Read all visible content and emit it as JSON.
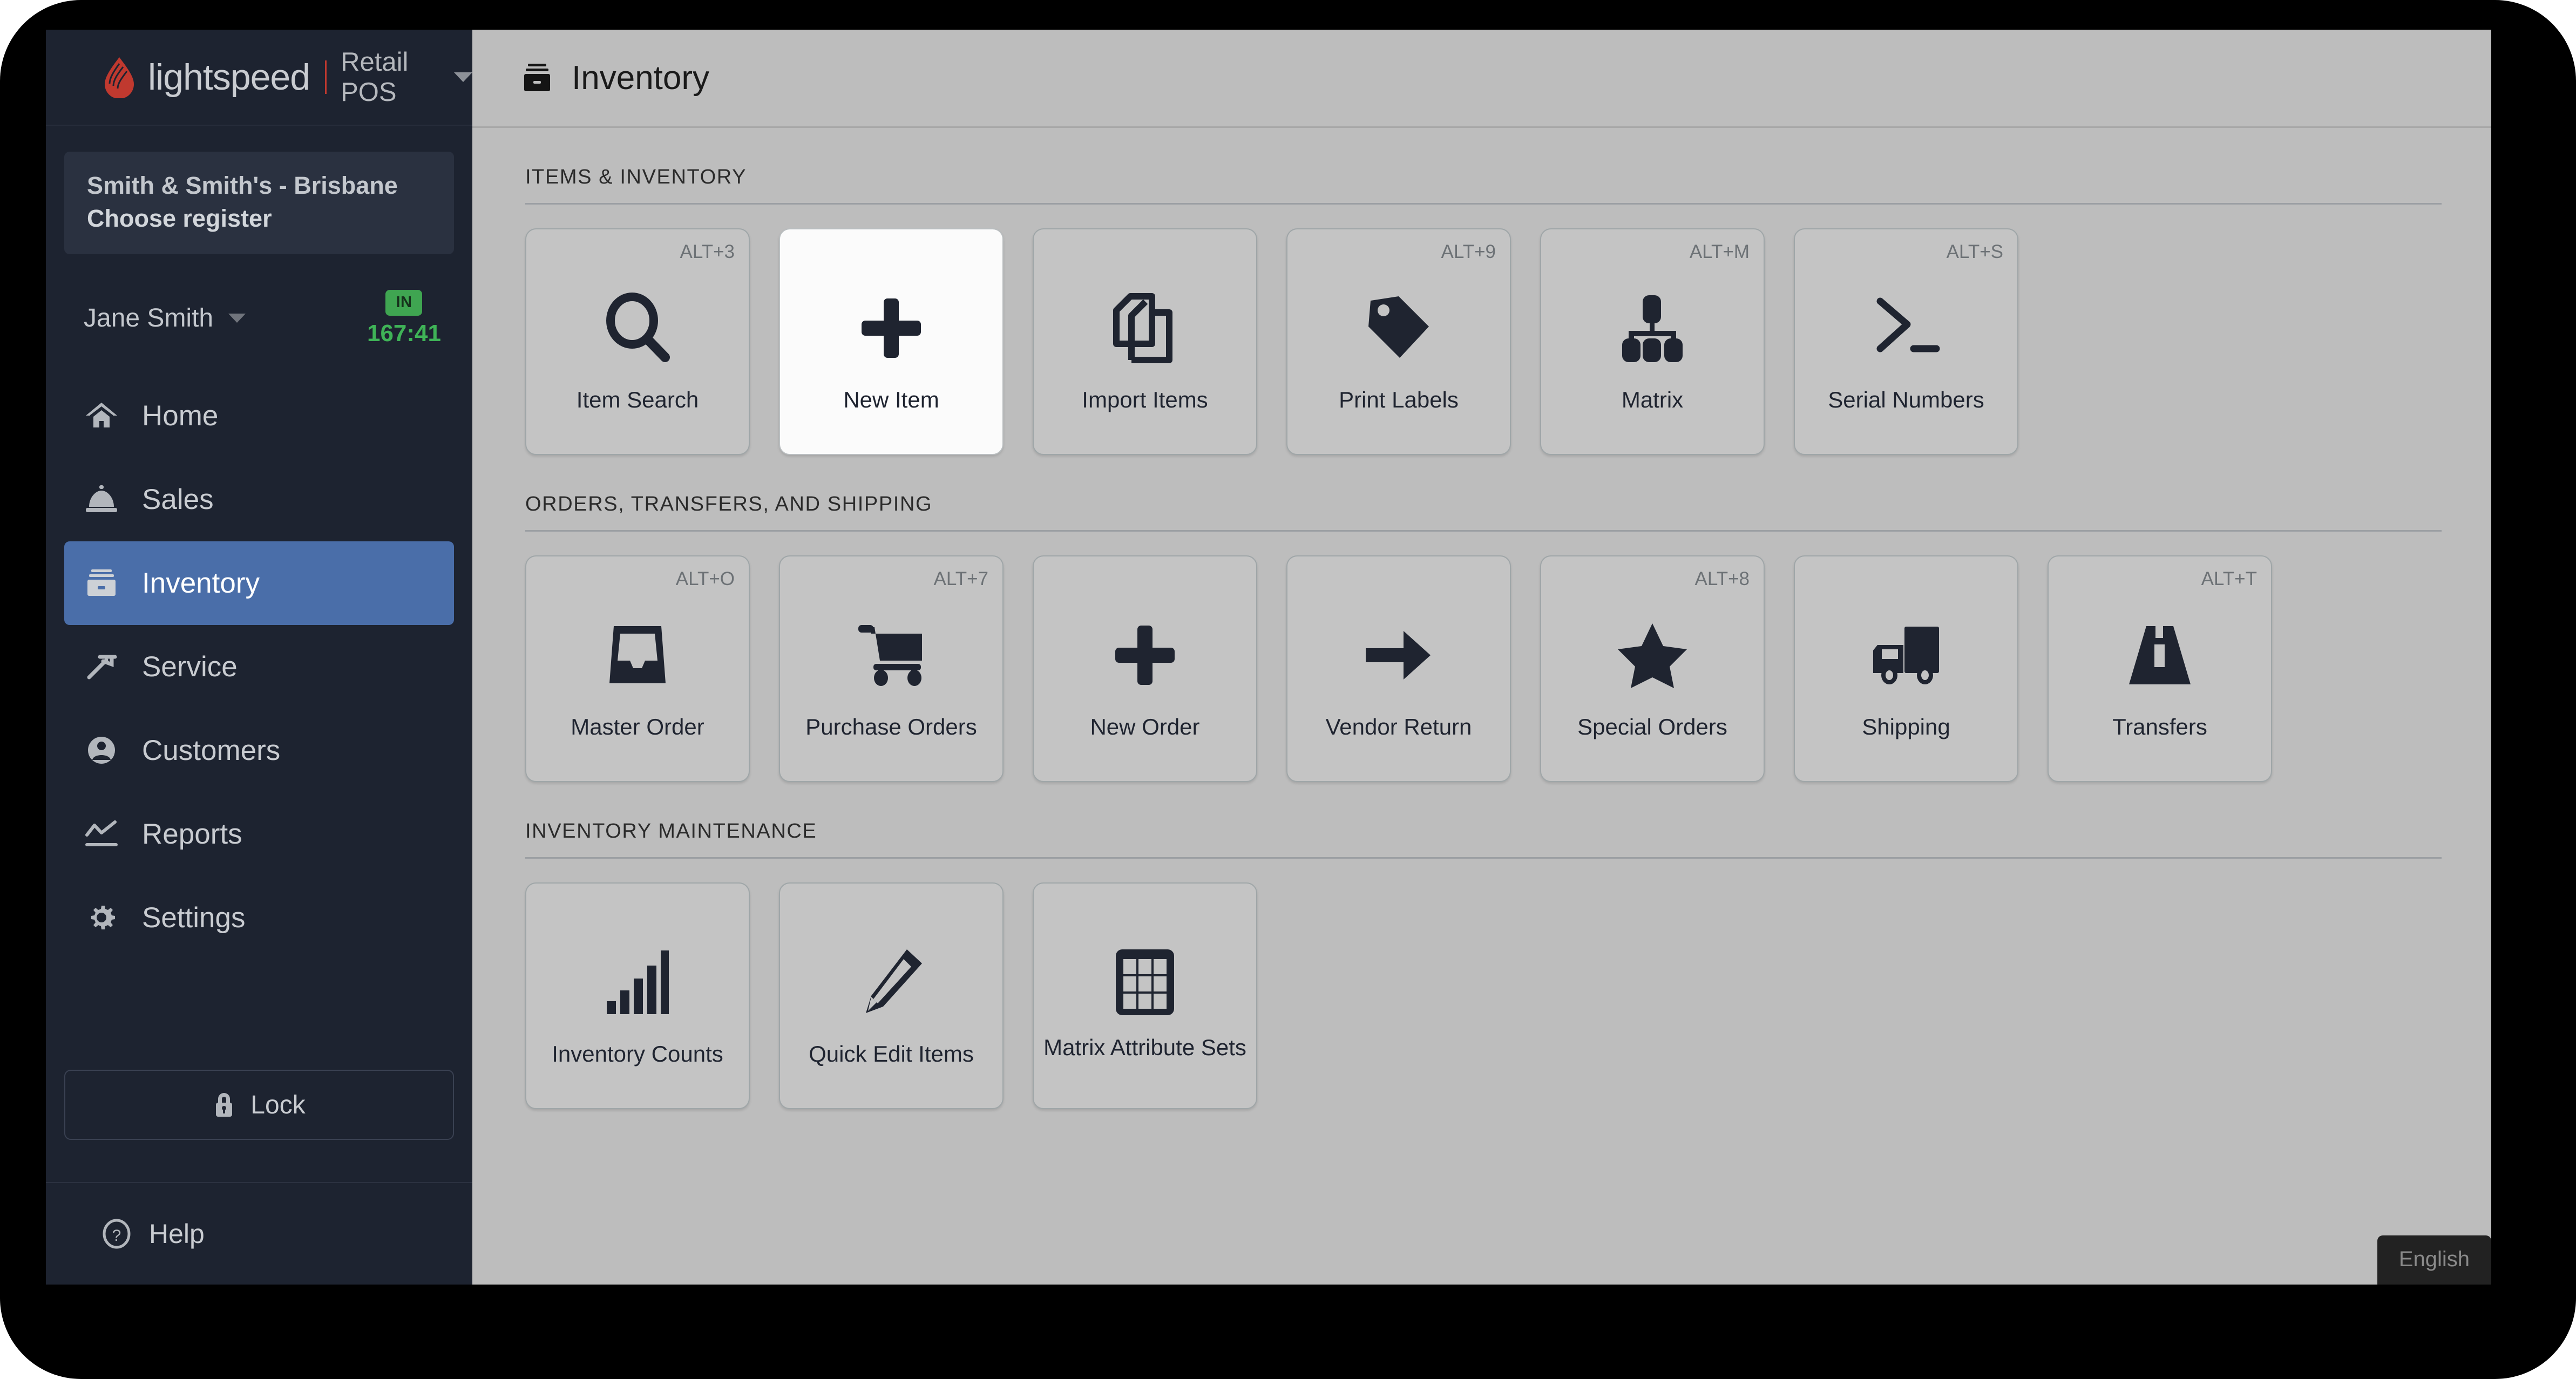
{
  "brand": {
    "flame_color": "#c0392f",
    "name": "lightspeed",
    "product": "Retail POS",
    "caret": "chevron-down-icon"
  },
  "sidebar": {
    "register": {
      "shop": "Smith & Smith's - Brisbane",
      "choose": "Choose register"
    },
    "user": {
      "name": "Jane Smith",
      "status_badge": "IN",
      "status_color": "#3fa551",
      "clock_time": "167:41",
      "clock_color": "#3fb357"
    },
    "nav_items": [
      {
        "label": "Home",
        "icon": "home-icon",
        "active": false
      },
      {
        "label": "Sales",
        "icon": "bell-icon",
        "active": false
      },
      {
        "label": "Inventory",
        "icon": "inventory-drawer-icon",
        "active": true
      },
      {
        "label": "Service",
        "icon": "hammer-icon",
        "active": false
      },
      {
        "label": "Customers",
        "icon": "person-circle-icon",
        "active": false
      },
      {
        "label": "Reports",
        "icon": "line-chart-icon",
        "active": false
      },
      {
        "label": "Settings",
        "icon": "gear-icon",
        "active": false
      }
    ],
    "active_color": "#4a6ea9",
    "lock_button": {
      "label": "Lock",
      "icon": "lock-icon"
    },
    "help": {
      "label": "Help",
      "icon": "question-circle-icon"
    }
  },
  "header": {
    "title": "Inventory",
    "icon": "inventory-drawer-icon"
  },
  "sections": [
    {
      "title": "ITEMS & INVENTORY",
      "tiles": [
        {
          "label": "Item Search",
          "shortcut": "ALT+3",
          "icon": "magnifier-icon",
          "selected": false
        },
        {
          "label": "New Item",
          "shortcut": "",
          "icon": "plus-icon",
          "selected": true
        },
        {
          "label": "Import Items",
          "shortcut": "",
          "icon": "copy-pages-icon",
          "selected": false
        },
        {
          "label": "Print Labels",
          "shortcut": "ALT+9",
          "icon": "price-tag-icon",
          "selected": false
        },
        {
          "label": "Matrix",
          "shortcut": "ALT+M",
          "icon": "org-tree-icon",
          "selected": false
        },
        {
          "label": "Serial Numbers",
          "shortcut": "ALT+S",
          "icon": "terminal-icon",
          "selected": false
        }
      ]
    },
    {
      "title": "ORDERS, TRANSFERS, AND SHIPPING",
      "tiles": [
        {
          "label": "Master Order",
          "shortcut": "ALT+O",
          "icon": "inbox-tray-icon",
          "selected": false
        },
        {
          "label": "Purchase Orders",
          "shortcut": "ALT+7",
          "icon": "shopping-cart-icon",
          "selected": false
        },
        {
          "label": "New Order",
          "shortcut": "",
          "icon": "plus-icon",
          "selected": false
        },
        {
          "label": "Vendor Return",
          "shortcut": "",
          "icon": "arrow-right-icon",
          "selected": false
        },
        {
          "label": "Special Orders",
          "shortcut": "ALT+8",
          "icon": "star-icon",
          "selected": false
        },
        {
          "label": "Shipping",
          "shortcut": "",
          "icon": "truck-icon",
          "selected": false
        },
        {
          "label": "Transfers",
          "shortcut": "ALT+T",
          "icon": "road-icon",
          "selected": false
        }
      ]
    },
    {
      "title": "INVENTORY MAINTENANCE",
      "tiles": [
        {
          "label": "Inventory Counts",
          "shortcut": "",
          "icon": "bar-chart-icon",
          "selected": false
        },
        {
          "label": "Quick Edit Items",
          "shortcut": "",
          "icon": "pencil-icon",
          "selected": false
        },
        {
          "label": "Matrix Attribute Sets",
          "shortcut": "",
          "icon": "grid-icon",
          "selected": false
        }
      ]
    }
  ],
  "language_badge": "English"
}
